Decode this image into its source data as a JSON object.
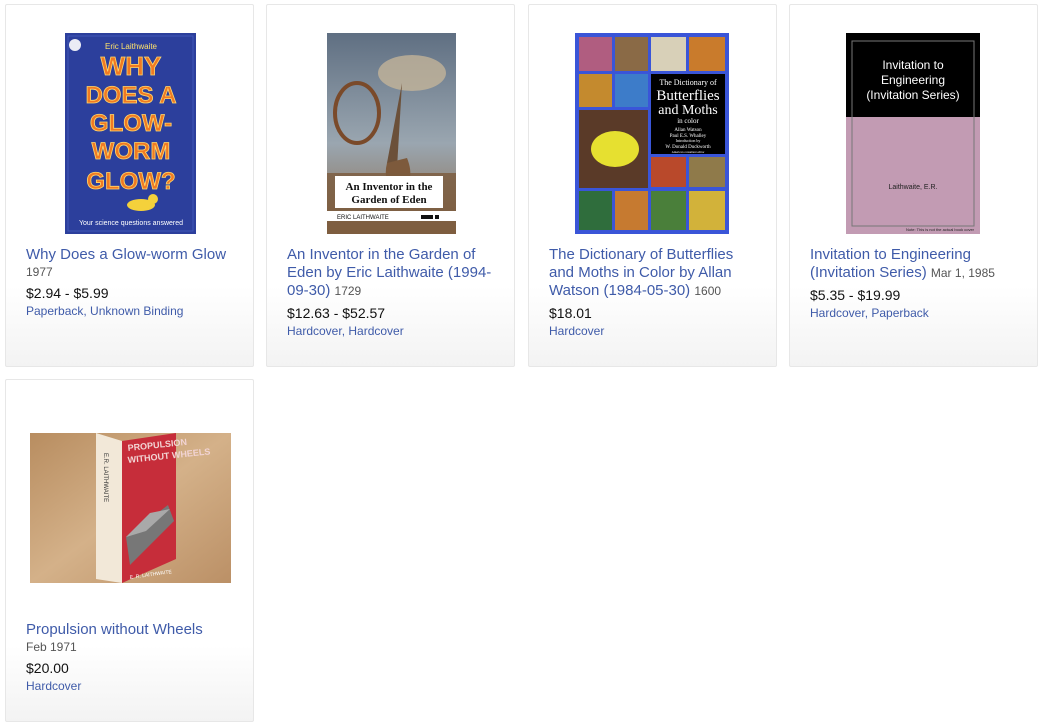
{
  "products": [
    {
      "title": "Why Does a Glow-worm Glow",
      "date": "1977",
      "price": "$2.94 - $5.99",
      "formats": [
        "Paperback",
        "Unknown Binding"
      ]
    },
    {
      "title": "An Inventor in the Garden of Eden by Eric Laithwaite (1994-09-30)",
      "date": "1729",
      "price": "$12.63 - $52.57",
      "formats": [
        "Hardcover",
        "Hardcover"
      ]
    },
    {
      "title": "The Dictionary of Butterflies and Moths in Color by Allan Watson (1984-05-30)",
      "date": "1600",
      "price": "$18.01",
      "formats": [
        "Hardcover"
      ]
    },
    {
      "title": "Invitation to Engineering (Invitation Series)",
      "date": "Mar 1, 1985",
      "price": "$5.35 - $19.99",
      "formats": [
        "Hardcover",
        "Paperback"
      ]
    },
    {
      "title": "Propulsion without Wheels",
      "date": "Feb 1971",
      "price": "$20.00",
      "formats": [
        "Hardcover"
      ]
    }
  ],
  "covers": {
    "glowworm": {
      "author": "Eric Laithwaite",
      "title_lines": [
        "WHY",
        "DOES A",
        "GLOW-",
        "WORM",
        "GLOW?"
      ],
      "tagline": "Your science questions answered",
      "colors": {
        "bg": "#2c3f9c",
        "title": "#f07a23",
        "text": "#ffe36b"
      }
    },
    "inventor": {
      "title_lines": [
        "An Inventor in the",
        "Garden of Eden"
      ],
      "author": "ERIC LAITHWAITE",
      "colors": {
        "sky": "#7e8fa2",
        "ground": "#8a6a4a",
        "label_bg": "#ffffff"
      }
    },
    "butterflies": {
      "title_lines": [
        "The Dictionary of",
        "Butterflies",
        "and Moths",
        "in color"
      ],
      "credits": [
        "Allan Watson",
        "Paul E.S. Whalley",
        "Introduction by",
        "W. Donald Duckworth",
        "American consultant editor"
      ],
      "colors": {
        "frame": "#3a55d8",
        "panel": "#000000"
      }
    },
    "invitation": {
      "title_lines": [
        "Invitation to",
        "Engineering",
        "(Invitation Series)"
      ],
      "author": "Laithwaite, E.R.",
      "note": "Note: This is not the actual book cover",
      "colors": {
        "top": "#000000",
        "bottom": "#c29bb3"
      }
    },
    "propulsion": {
      "spine_author": "E.R. LAITHWAITE",
      "title_lines": [
        "PROPULSION",
        "WITHOUT WHEELS"
      ],
      "front_author": "E. R. LAITHWAITE",
      "colors": {
        "wood": "#c9a47a",
        "cover": "#c62d3a"
      }
    }
  }
}
